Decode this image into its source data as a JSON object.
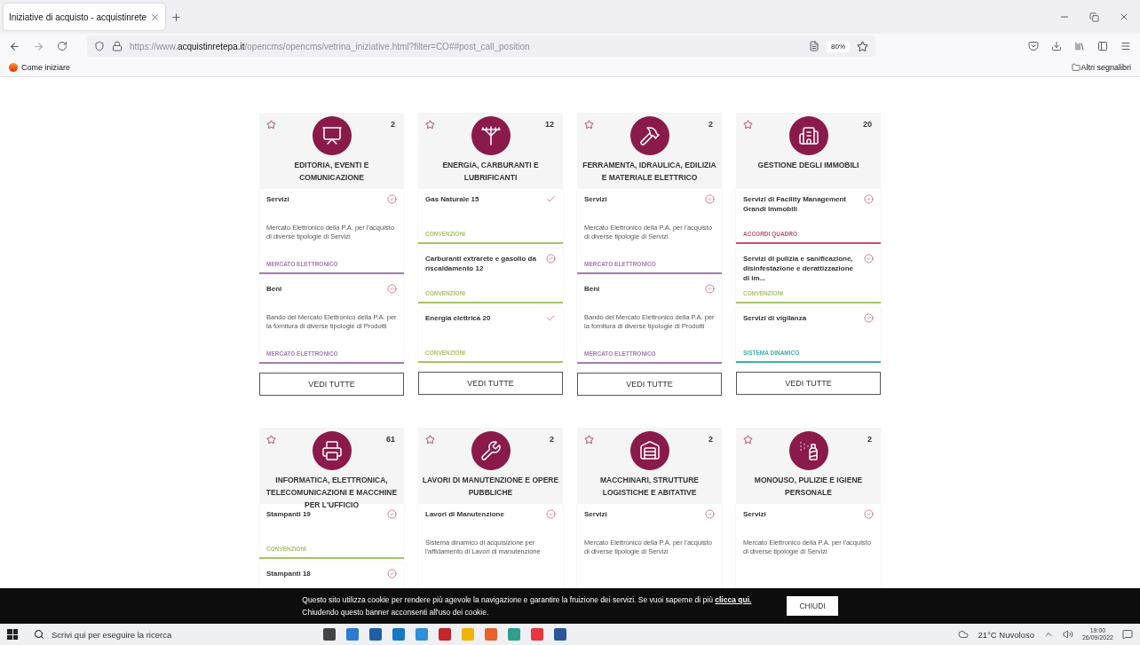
{
  "browser": {
    "tab": {
      "title": "Iniziative di acquisto - acquistinrete"
    },
    "url": {
      "prefix": "https://www.",
      "domain": "acquistinretepa.it",
      "path": "/opencms/opencms/vetrina_iniziative.html?filter=CO##post_call_position"
    },
    "zoom": "80%",
    "bookmarks": [
      {
        "label": "Come iniziare"
      }
    ],
    "other_bookmarks": "Altri segnalibri"
  },
  "categories": [
    {
      "title": "EDITORIA, EVENTI E COMUNICAZIONE",
      "count": "2",
      "kind": "media",
      "favorite": false,
      "button": "VEDI TUTTE",
      "items": [
        {
          "title": "Servizi",
          "description": "Mercato Elettronico della P.A. per l'acquisto di diverse tipologie di Servizi",
          "tag": "MERCATO ELETTRONICO",
          "color": "#a57bb0",
          "kind": "circle"
        },
        {
          "title": "Beni",
          "description": "Bando del Mercato Elettronico della P.A. per la fornitura di diverse tipologie di Prodotti",
          "tag": "MERCATO ELETTRONICO",
          "color": "#a57bb0",
          "kind": "circle"
        }
      ]
    },
    {
      "title": "ENERGIA, CARBURANTI E LUBRIFICANTI",
      "count": "12",
      "kind": "energy",
      "favorite": false,
      "button": "VEDI TUTTE",
      "items": [
        {
          "title": "Gas Naturale 15",
          "tag": "CONVENZIONI",
          "color": "#a9c26a",
          "kind": "tick"
        },
        {
          "title": "Carburanti extrarete e gasolio da riscaldamento 12",
          "tag": "CONVENZIONI",
          "color": "#a9c26a",
          "kind": "circle"
        },
        {
          "title": "Energia elettrica 20",
          "tag": "CONVENZIONI",
          "color": "#a9c26a",
          "kind": "tick"
        }
      ]
    },
    {
      "title": "FERRAMENTA, IDRAULICA, EDILIZIA E MATERIALE ELETTRICO",
      "count": "2",
      "kind": "tools",
      "favorite": false,
      "button": "VEDI TUTTE",
      "items": [
        {
          "title": "Servizi",
          "description": "Mercato Elettronico della P.A. per l'acquisto di diverse tipologie di Servizi",
          "tag": "MERCATO ELETTRONICO",
          "color": "#a57bb0",
          "kind": "circle"
        },
        {
          "title": "Beni",
          "description": "Bando del Mercato Elettronico della P.A. per la fornitura di diverse tipologie di Prodotti",
          "tag": "MERCATO ELETTRONICO",
          "color": "#a57bb0",
          "kind": "circle"
        }
      ]
    },
    {
      "title": "GESTIONE DEGLI IMMOBILI",
      "count": "20",
      "kind": "building",
      "favorite": false,
      "button": "VEDI TUTTE",
      "items": [
        {
          "title": "Servizi di Facility Management Grandi Immobili",
          "tag": "ACCORDI QUADRO",
          "color": "#c8506f",
          "kind": "circle"
        },
        {
          "title": "Servizi di pulizia e sanificazione, disinfestazione e derattizzazione di im...",
          "tag": "CONVENZIONI",
          "color": "#a9c26a",
          "kind": "circle"
        },
        {
          "title": "Servizi di vigilanza",
          "tag": "SISTEMA DINAMICO",
          "color": "#3fb3a5",
          "kind": "circle"
        }
      ]
    },
    {
      "title": "INFORMATICA, ELETTRONICA, TELECOMUNICAZIONI E MACCHINE PER L'UFFICIO",
      "count": "61",
      "kind": "printer",
      "favorite": false,
      "items": [
        {
          "title": "Stampanti 19",
          "tag": "CONVENZIONI",
          "color": "#a9c26a",
          "kind": "circle"
        },
        {
          "title": "Stampanti 18",
          "kind": "circle"
        }
      ]
    },
    {
      "title": "LAVORI DI MANUTENZIONE E OPERE PUBBLICHE",
      "count": "2",
      "kind": "wrench",
      "favorite": false,
      "items": [
        {
          "title": "Lavori di Manutenzione",
          "description": "Sistema dinamico di acquisizione per l'affidamento di Lavori di manutenzione",
          "kind": "circle"
        }
      ]
    },
    {
      "title": "MACCHINARI, STRUTTURE LOGISTICHE E ABITATIVE",
      "count": "2",
      "kind": "warehouse",
      "favorite": false,
      "items": [
        {
          "title": "Servizi",
          "description": "Mercato Elettronico della P.A. per l'acquisto di diverse tipologie di Servizi",
          "kind": "circle"
        }
      ]
    },
    {
      "title": "MONOUSO, PULIZIE E IGIENE PERSONALE",
      "count": "2",
      "kind": "spray",
      "favorite": false,
      "items": [
        {
          "title": "Servizi",
          "description": "Mercato Elettronico della P.A. per l'acquisto di diverse tipologie di Servizi",
          "kind": "circle"
        }
      ]
    }
  ],
  "cookie_banner": {
    "text": "Questo sito utilizza cookie per rendere più agevole la navigazione e garantire la fruizione dei servizi. Se vuoi saperne di più",
    "link": "clicca qui.",
    "text_2": "Chiudendo questo banner acconsenti all'uso dei cookie.",
    "button": "CHIUDI"
  },
  "taskbar": {
    "search_placeholder": "Scrivi qui per eseguire la ricerca",
    "weather": "21°C Nuvoloso",
    "time": "19:00",
    "date": "26/09/2022"
  }
}
